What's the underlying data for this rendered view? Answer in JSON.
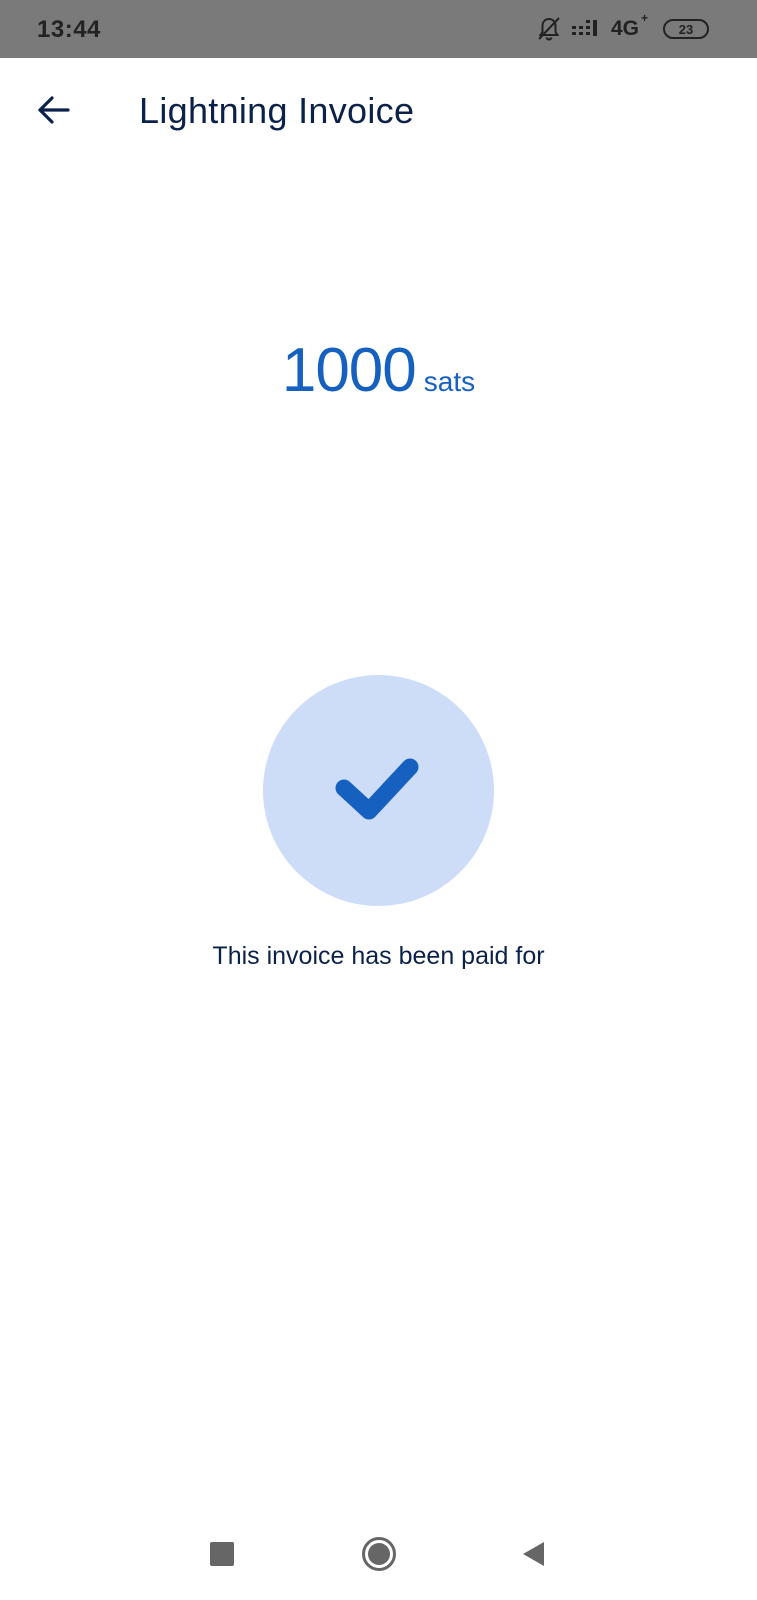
{
  "status_bar": {
    "time": "13:44",
    "network_type": "4G",
    "network_superscript": "+",
    "battery_level": "23",
    "icons": [
      "notifications-off-icon",
      "signal-icon",
      "battery-icon"
    ]
  },
  "app_bar": {
    "title": "Lightning Invoice",
    "back_icon": "arrow-back-icon"
  },
  "invoice": {
    "amount": "1000",
    "unit": "sats",
    "status_message": "This invoice has been paid for",
    "status_icon": "checkmark-icon"
  },
  "colors": {
    "accent": "#1660c0",
    "text_primary": "#0c2149",
    "success_circle": "#ceddf7",
    "status_bar_bg": "#7a7a7a"
  },
  "nav_bar": {
    "icons": [
      "recents-square-icon",
      "home-circle-icon",
      "back-triangle-icon"
    ]
  }
}
